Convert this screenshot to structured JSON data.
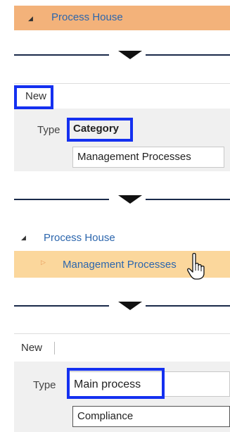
{
  "panel1": {
    "tree_root_label": "Process House"
  },
  "panel2": {
    "new_label": "New",
    "type_label": "Type",
    "type_value": "Category",
    "name_value": "Management Processes"
  },
  "panel3": {
    "tree_root_label": "Process House",
    "tree_child_label": "Management Processes"
  },
  "panel4": {
    "new_label": "New",
    "type_label": "Type",
    "type_value": "Main process",
    "name_value": "Compliance"
  },
  "colors": {
    "selected_row": "#f3b27a",
    "hover_row": "#fbd79c",
    "highlight_box": "#1430f0",
    "link_text": "#2c66ad"
  }
}
